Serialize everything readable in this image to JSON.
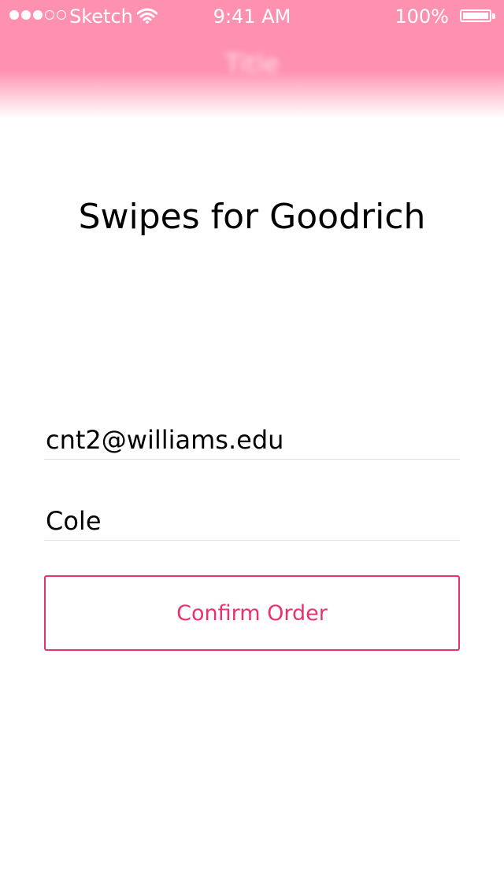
{
  "status_bar": {
    "signal_bars": "●●●○○",
    "carrier": "Sketch",
    "time": "9:41 AM",
    "battery_percent": "100%",
    "battery_level": 1.0
  },
  "nav": {
    "title": "Title"
  },
  "page": {
    "title": "Swipes for Goodrich"
  },
  "form": {
    "email_value": "cnt2@williams.edu",
    "name_value": "Cole",
    "confirm_label": "Confirm Order"
  },
  "colors": {
    "header": "#ff91b0",
    "accent": "#e8326e",
    "divider": "#e0e0e0"
  },
  "icons": {
    "wifi": "wifi-icon",
    "battery": "battery-icon",
    "signal": "signal-strength-icon"
  }
}
